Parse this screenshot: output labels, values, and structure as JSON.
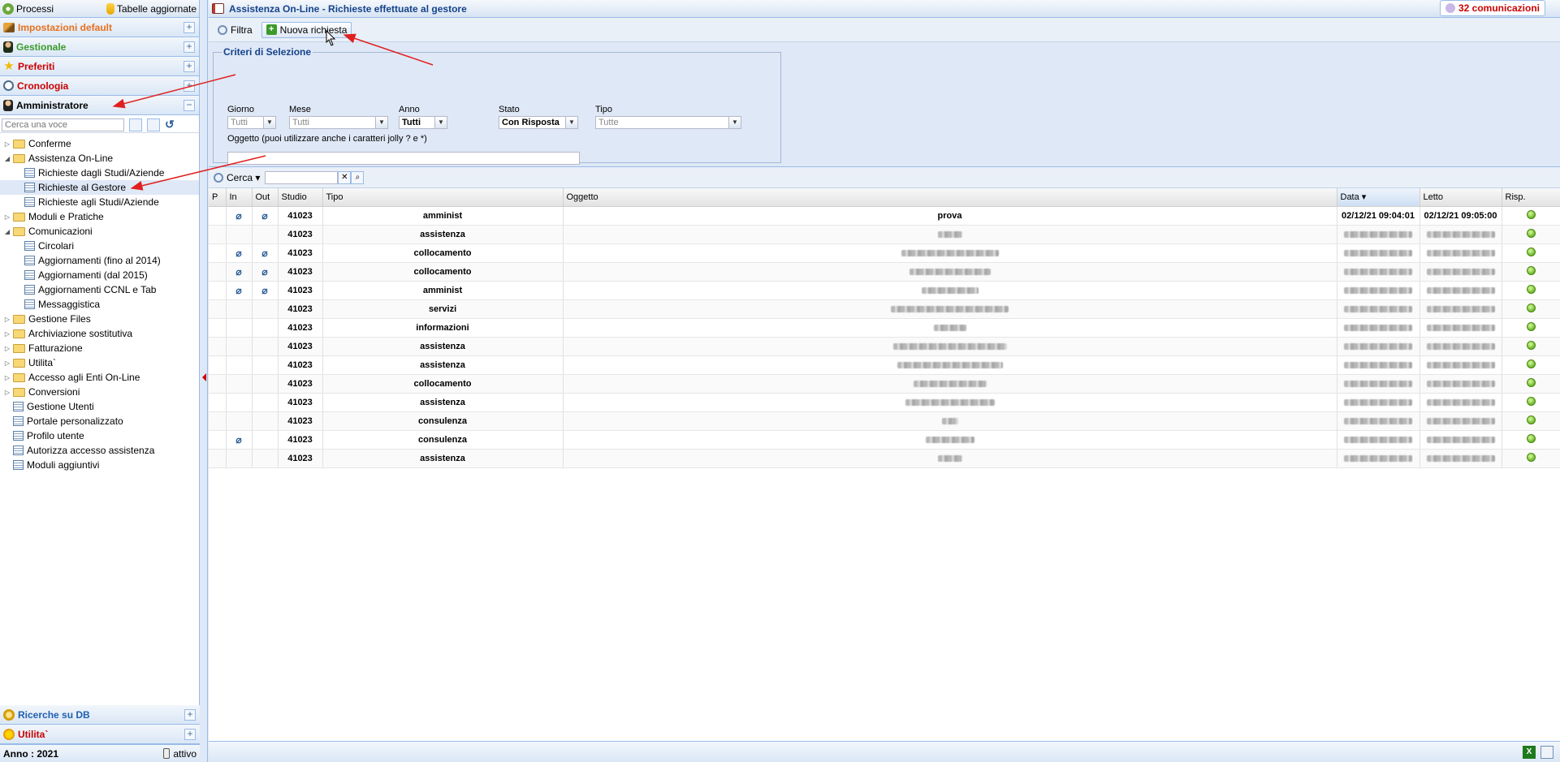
{
  "sidebar": {
    "top": {
      "processi": "Processi",
      "tabelle": "Tabelle aggiornate"
    },
    "sections": [
      {
        "label": "Impostazioni default",
        "color": "#e8711e",
        "toggle": "+"
      },
      {
        "label": "Gestionale",
        "color": "#3a9b2a",
        "toggle": "+"
      },
      {
        "label": "Preferiti",
        "color": "#cc0000",
        "toggle": "+"
      },
      {
        "label": "Cronologia",
        "color": "#cc0000",
        "toggle": "+"
      },
      {
        "label": "Amministratore",
        "color": "#000000",
        "toggle": "−"
      }
    ],
    "search_placeholder": "Cerca una voce",
    "tree": [
      {
        "label": "Conferme",
        "type": "folder",
        "level": 0,
        "expander": "▷"
      },
      {
        "label": "Assistenza On-Line",
        "type": "folder",
        "level": 0,
        "expander": "◢"
      },
      {
        "label": "Richieste dagli Studi/Aziende",
        "type": "doc",
        "level": 1
      },
      {
        "label": "Richieste al Gestore",
        "type": "doc",
        "level": 1,
        "selected": true
      },
      {
        "label": "Richieste agli Studi/Aziende",
        "type": "doc",
        "level": 1
      },
      {
        "label": "Moduli e Pratiche",
        "type": "folder",
        "level": 0,
        "expander": "▷"
      },
      {
        "label": "Comunicazioni",
        "type": "folder",
        "level": 0,
        "expander": "◢"
      },
      {
        "label": "Circolari",
        "type": "doc",
        "level": 1
      },
      {
        "label": "Aggiornamenti (fino al 2014)",
        "type": "doc",
        "level": 1
      },
      {
        "label": "Aggiornamenti (dal 2015)",
        "type": "doc",
        "level": 1
      },
      {
        "label": "Aggiornamenti CCNL e Tab",
        "type": "doc",
        "level": 1
      },
      {
        "label": "Messaggistica",
        "type": "doc",
        "level": 1
      },
      {
        "label": "Gestione Files",
        "type": "folder",
        "level": 0,
        "expander": "▷"
      },
      {
        "label": "Archiviazione sostitutiva",
        "type": "folder",
        "level": 0,
        "expander": "▷"
      },
      {
        "label": "Fatturazione",
        "type": "folder",
        "level": 0,
        "expander": "▷"
      },
      {
        "label": "Utilita`",
        "type": "folder",
        "level": 0,
        "expander": "▷"
      },
      {
        "label": "Accesso agli Enti On-Line",
        "type": "folder",
        "level": 0,
        "expander": "▷"
      },
      {
        "label": "Conversioni",
        "type": "folder",
        "level": 0,
        "expander": "▷"
      },
      {
        "label": "Gestione Utenti",
        "type": "doc",
        "level": 0
      },
      {
        "label": "Portale personalizzato",
        "type": "doc",
        "level": 0
      },
      {
        "label": "Profilo utente",
        "type": "doc",
        "level": 0
      },
      {
        "label": "Autorizza accesso assistenza",
        "type": "doc",
        "level": 0
      },
      {
        "label": "Moduli aggiuntivi",
        "type": "doc",
        "level": 0
      }
    ],
    "bottom_sections": [
      {
        "label": "Ricerche su DB",
        "color": "#1f5fb0",
        "toggle": "+"
      },
      {
        "label": "Utilita`",
        "color": "#cc0000",
        "toggle": "+"
      }
    ],
    "footer": {
      "anno": "Anno : 2021",
      "status": "attivo"
    }
  },
  "main": {
    "title": "Assistenza On-Line - Richieste effettuate al gestore",
    "communications": "32 comunicazioni",
    "toolbar": {
      "filtra": "Filtra",
      "nuova": "Nuova richiesta"
    },
    "filter": {
      "legend": "Criteri di Selezione",
      "giorno": {
        "label": "Giorno",
        "value": "Tutti"
      },
      "mese": {
        "label": "Mese",
        "value": "Tutti"
      },
      "anno": {
        "label": "Anno",
        "value": "Tutti"
      },
      "stato": {
        "label": "Stato",
        "value": "Con Risposta"
      },
      "tipo": {
        "label": "Tipo",
        "value": "Tutte"
      },
      "oggetto_label": "Oggetto (puoi utilizzare anche i caratteri jolly ? e *)"
    },
    "grid_toolbar": {
      "cerca": "Cerca ▾",
      "clear": "✕"
    },
    "columns": [
      "P",
      "In",
      "Out",
      "Studio",
      "Tipo",
      "Oggetto",
      "Data ▾",
      "Letto",
      "Risp."
    ],
    "rows": [
      {
        "in": true,
        "out": true,
        "studio": "41023",
        "tipo": "amminist",
        "oggetto": "prova",
        "data": "02/12/21 09:04:01",
        "letto": "02/12/21 09:05:00",
        "blurred": false,
        "blur_w": 0
      },
      {
        "in": false,
        "out": false,
        "studio": "41023",
        "tipo": "assistenza",
        "oggetto": "",
        "data": "",
        "letto": "",
        "blurred": true,
        "blur_w": 30
      },
      {
        "in": true,
        "out": true,
        "studio": "41023",
        "tipo": "collocamento",
        "oggetto": "",
        "data": "",
        "letto": "",
        "blurred": true,
        "blur_w": 120
      },
      {
        "in": true,
        "out": true,
        "studio": "41023",
        "tipo": "collocamento",
        "oggetto": "",
        "data": "",
        "letto": "",
        "blurred": true,
        "blur_w": 100
      },
      {
        "in": true,
        "out": true,
        "studio": "41023",
        "tipo": "amminist",
        "oggetto": "",
        "data": "",
        "letto": "",
        "blurred": true,
        "blur_w": 70
      },
      {
        "in": false,
        "out": false,
        "studio": "41023",
        "tipo": "servizi",
        "oggetto": "",
        "data": "",
        "letto": "",
        "blurred": true,
        "blur_w": 145
      },
      {
        "in": false,
        "out": false,
        "studio": "41023",
        "tipo": "informazioni",
        "oggetto": "",
        "data": "",
        "letto": "",
        "blurred": true,
        "blur_w": 40
      },
      {
        "in": false,
        "out": false,
        "studio": "41023",
        "tipo": "assistenza",
        "oggetto": "",
        "data": "",
        "letto": "",
        "blurred": true,
        "blur_w": 140
      },
      {
        "in": false,
        "out": false,
        "studio": "41023",
        "tipo": "assistenza",
        "oggetto": "",
        "data": "",
        "letto": "",
        "blurred": true,
        "blur_w": 130
      },
      {
        "in": false,
        "out": false,
        "studio": "41023",
        "tipo": "collocamento",
        "oggetto": "",
        "data": "",
        "letto": "",
        "blurred": true,
        "blur_w": 90
      },
      {
        "in": false,
        "out": false,
        "studio": "41023",
        "tipo": "assistenza",
        "oggetto": "",
        "data": "",
        "letto": "",
        "blurred": true,
        "blur_w": 110
      },
      {
        "in": false,
        "out": false,
        "studio": "41023",
        "tipo": "consulenza",
        "oggetto": "",
        "data": "",
        "letto": "",
        "blurred": true,
        "blur_w": 20
      },
      {
        "in": true,
        "out": false,
        "studio": "41023",
        "tipo": "consulenza",
        "oggetto": "",
        "data": "",
        "letto": "",
        "blurred": true,
        "blur_w": 60
      },
      {
        "in": false,
        "out": false,
        "studio": "41023",
        "tipo": "assistenza",
        "oggetto": "",
        "data": "",
        "letto": "",
        "blurred": true,
        "blur_w": 30
      }
    ]
  }
}
